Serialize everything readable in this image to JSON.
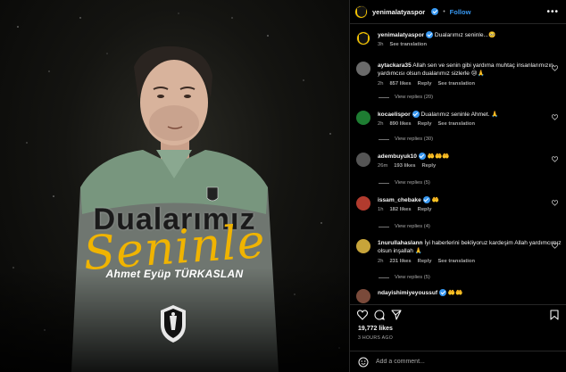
{
  "post": {
    "username": "yenimalatyaspor",
    "follow_label": "Follow",
    "more_label": "•••",
    "dot": "•",
    "caption": "Dualarımız seninle...🥺",
    "caption_time": "3h",
    "caption_translate": "See translation"
  },
  "image": {
    "headline_top": "Dualarımız",
    "headline_script": "Seninle",
    "player_name": "Ahmet Eyüp TÜRKASLAN"
  },
  "comments": [
    {
      "user": "aytackara35",
      "text": "Allah sen ve senin gibi yardıma muhtaç insanlarımızın yardımcısı olsun dualarımız sizlerle 😢🙏",
      "time": "2h",
      "likes": "857 likes",
      "reply": "Reply",
      "translate": "See translation",
      "view_replies": "View replies (20)",
      "avatar_color": "#6a6a6a"
    },
    {
      "user": "kocaelispor",
      "verified": true,
      "text": "Dualarımız seninle Ahmet. 🙏",
      "time": "2h",
      "likes": "890 likes",
      "reply": "Reply",
      "translate": "See translation",
      "view_replies": "View replies (30)",
      "avatar_color": "#1e7d32"
    },
    {
      "user": "adembuyuk10",
      "verified": true,
      "text": "🤲🤲🤲",
      "time": "26m",
      "likes": "193 likes",
      "reply": "Reply",
      "view_replies": "View replies (5)",
      "avatar_color": "#555"
    },
    {
      "user": "issam_chebake",
      "verified": true,
      "text": "🤲",
      "time": "1h",
      "likes": "182 likes",
      "reply": "Reply",
      "view_replies": "View replies (4)",
      "avatar_color": "#b23b2e"
    },
    {
      "user": "1nurullahaslann",
      "text": "İyi haberlerini bekliyoruz kardeşim Allah yardımcımız olsun inşallah 🙏",
      "time": "2h",
      "likes": "231 likes",
      "reply": "Reply",
      "translate": "See translation",
      "view_replies": "View replies (5)",
      "avatar_color": "#c7a43a"
    },
    {
      "user": "ndayishimiyeyoussuf",
      "verified": true,
      "text": "🤲🤲",
      "avatar_color": "#7a4a3a"
    }
  ],
  "footer": {
    "likes": "19,772 likes",
    "ago": "3 HOURS AGO",
    "add_comment_placeholder": "Add a comment..."
  },
  "colors": {
    "accent": "#3797f0",
    "brand_yellow": "#f5c400",
    "script_gold": "#f0b400"
  }
}
